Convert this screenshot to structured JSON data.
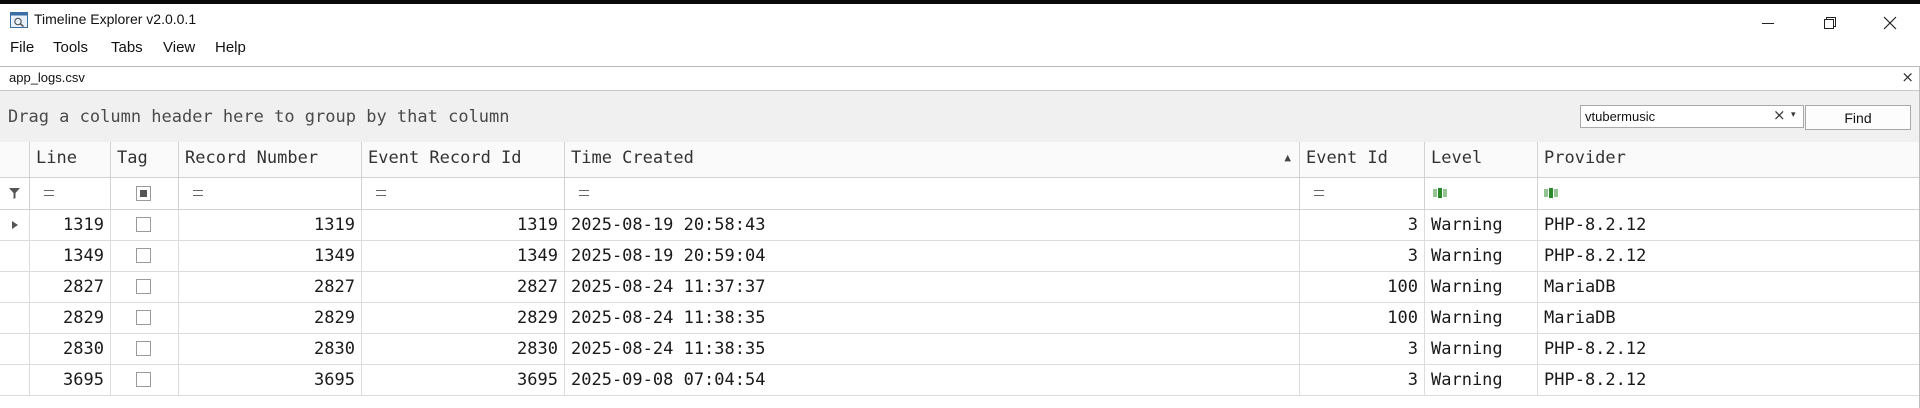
{
  "window": {
    "title": "Timeline Explorer v2.0.0.1"
  },
  "menu": [
    "File",
    "Tools",
    "Tabs",
    "View",
    "Help"
  ],
  "tab": {
    "label": "app_logs.csv",
    "close": "×"
  },
  "group_panel": {
    "hint": "Drag a column header here to group by that column"
  },
  "search": {
    "value": "vtubermusic",
    "clear": "×",
    "dropdown": "▾",
    "find_label": "Find"
  },
  "columns": {
    "line": "Line",
    "tag": "Tag",
    "record_number": "Record Number",
    "event_record_id": "Event Record Id",
    "time_created": "Time Created",
    "event_id": "Event Id",
    "level": "Level",
    "provider": "Provider"
  },
  "sort_indicator": "▲",
  "rows": [
    {
      "line": "1319",
      "record_number": "1319",
      "event_record_id": "1319",
      "time_created": "2025-08-19 20:58:43",
      "event_id": "3",
      "level": "Warning",
      "provider": "PHP-8.2.12"
    },
    {
      "line": "1349",
      "record_number": "1349",
      "event_record_id": "1349",
      "time_created": "2025-08-19 20:59:04",
      "event_id": "3",
      "level": "Warning",
      "provider": "PHP-8.2.12"
    },
    {
      "line": "2827",
      "record_number": "2827",
      "event_record_id": "2827",
      "time_created": "2025-08-24 11:37:37",
      "event_id": "100",
      "level": "Warning",
      "provider": "MariaDB"
    },
    {
      "line": "2829",
      "record_number": "2829",
      "event_record_id": "2829",
      "time_created": "2025-08-24 11:38:35",
      "event_id": "100",
      "level": "Warning",
      "provider": "MariaDB"
    },
    {
      "line": "2830",
      "record_number": "2830",
      "event_record_id": "2830",
      "time_created": "2025-08-24 11:38:35",
      "event_id": "3",
      "level": "Warning",
      "provider": "PHP-8.2.12"
    },
    {
      "line": "3695",
      "record_number": "3695",
      "event_record_id": "3695",
      "time_created": "2025-09-08 07:04:54",
      "event_id": "3",
      "level": "Warning",
      "provider": "PHP-8.2.12"
    }
  ],
  "colors": {
    "accent": "#2a8a2a",
    "grid_line": "#d2d2d2",
    "panel_bg": "#f0f0f0"
  }
}
